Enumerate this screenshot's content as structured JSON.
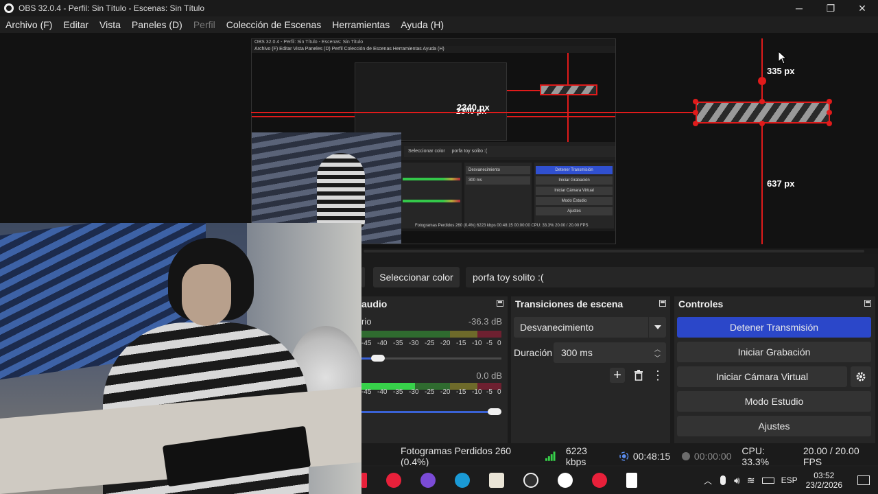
{
  "window": {
    "title": "OBS 32.0.4 - Perfil: Sin Título - Escenas: Sin Título",
    "minimize": "─",
    "maximize": "❐",
    "close": "✕"
  },
  "menu": [
    {
      "label": "Archivo (F)",
      "enabled": true
    },
    {
      "label": "Editar",
      "enabled": true
    },
    {
      "label": "Vista",
      "enabled": true
    },
    {
      "label": "Paneles (D)",
      "enabled": true
    },
    {
      "label": "Perfil",
      "enabled": false
    },
    {
      "label": "Colección de Escenas",
      "enabled": true
    },
    {
      "label": "Herramientas",
      "enabled": true
    },
    {
      "label": "Ayuda (H)",
      "enabled": true
    }
  ],
  "preview": {
    "measure_top": "335 px",
    "measure_bottom": "637 px",
    "measure_left": "2340 px",
    "nested_title": "OBS 32.0.4 - Perfil: Sin Título - Escenas: Sin Título",
    "nested_menu": "Archivo (F)   Editar   Vista   Paneles (D)   Perfil   Colección de Escenas   Herramientas   Ayuda (H)",
    "nested_select_color": "Seleccionar color",
    "nested_text": "porfa toy solito :(",
    "nested_status": "Fotogramas Perdidos 260 (0.4%)   6223 kbps   00:48:15   00:00:00   CPU: 33.3%   20.00 / 20.00 FPS"
  },
  "source_toolbar": {
    "select_color": "Seleccionar color",
    "text_value": "porfa toy solito :("
  },
  "audio": {
    "header": "audio",
    "track1_name": "rio",
    "track1_db": "-36.3 dB",
    "track2_db": "0.0 dB",
    "scale": [
      "-45",
      "-40",
      "-35",
      "-30",
      "-25",
      "-20",
      "-15",
      "-10",
      "-5",
      "0"
    ],
    "track1_volume": 0.12,
    "track2_volume": 0.95
  },
  "transitions": {
    "header": "Transiciones de escena",
    "selected": "Desvanecimiento",
    "duration_label": "Duración",
    "duration_value": "300 ms"
  },
  "controls": {
    "header": "Controles",
    "stop_stream": "Detener Transmisión",
    "start_recording": "Iniciar Grabación",
    "start_virtual_cam": "Iniciar Cámara Virtual",
    "studio_mode": "Modo Estudio",
    "settings": "Ajustes",
    "accent": "#2b47c9"
  },
  "status": {
    "dropped_frames": "Fotogramas Perdidos 260 (0.4%)",
    "bitrate": "6223 kbps",
    "stream_time": "00:48:15",
    "record_time": "00:00:00",
    "cpu": "CPU: 33.3%",
    "fps": "20.00 / 20.00 FPS"
  },
  "taskbar": {
    "lang": "ESP",
    "time": "03:52",
    "date": "23/2/2026"
  }
}
